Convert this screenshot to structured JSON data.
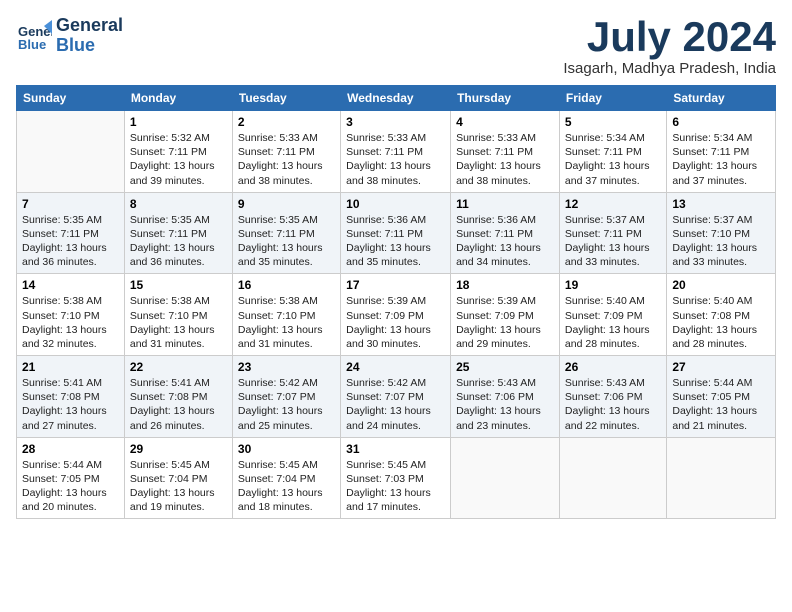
{
  "logo": {
    "line1": "General",
    "line2": "Blue"
  },
  "title": "July 2024",
  "subtitle": "Isagarh, Madhya Pradesh, India",
  "columns": [
    "Sunday",
    "Monday",
    "Tuesday",
    "Wednesday",
    "Thursday",
    "Friday",
    "Saturday"
  ],
  "weeks": [
    [
      {
        "day": "",
        "text": ""
      },
      {
        "day": "1",
        "text": "Sunrise: 5:32 AM\nSunset: 7:11 PM\nDaylight: 13 hours\nand 39 minutes."
      },
      {
        "day": "2",
        "text": "Sunrise: 5:33 AM\nSunset: 7:11 PM\nDaylight: 13 hours\nand 38 minutes."
      },
      {
        "day": "3",
        "text": "Sunrise: 5:33 AM\nSunset: 7:11 PM\nDaylight: 13 hours\nand 38 minutes."
      },
      {
        "day": "4",
        "text": "Sunrise: 5:33 AM\nSunset: 7:11 PM\nDaylight: 13 hours\nand 38 minutes."
      },
      {
        "day": "5",
        "text": "Sunrise: 5:34 AM\nSunset: 7:11 PM\nDaylight: 13 hours\nand 37 minutes."
      },
      {
        "day": "6",
        "text": "Sunrise: 5:34 AM\nSunset: 7:11 PM\nDaylight: 13 hours\nand 37 minutes."
      }
    ],
    [
      {
        "day": "7",
        "text": "Sunrise: 5:35 AM\nSunset: 7:11 PM\nDaylight: 13 hours\nand 36 minutes."
      },
      {
        "day": "8",
        "text": "Sunrise: 5:35 AM\nSunset: 7:11 PM\nDaylight: 13 hours\nand 36 minutes."
      },
      {
        "day": "9",
        "text": "Sunrise: 5:35 AM\nSunset: 7:11 PM\nDaylight: 13 hours\nand 35 minutes."
      },
      {
        "day": "10",
        "text": "Sunrise: 5:36 AM\nSunset: 7:11 PM\nDaylight: 13 hours\nand 35 minutes."
      },
      {
        "day": "11",
        "text": "Sunrise: 5:36 AM\nSunset: 7:11 PM\nDaylight: 13 hours\nand 34 minutes."
      },
      {
        "day": "12",
        "text": "Sunrise: 5:37 AM\nSunset: 7:11 PM\nDaylight: 13 hours\nand 33 minutes."
      },
      {
        "day": "13",
        "text": "Sunrise: 5:37 AM\nSunset: 7:10 PM\nDaylight: 13 hours\nand 33 minutes."
      }
    ],
    [
      {
        "day": "14",
        "text": "Sunrise: 5:38 AM\nSunset: 7:10 PM\nDaylight: 13 hours\nand 32 minutes."
      },
      {
        "day": "15",
        "text": "Sunrise: 5:38 AM\nSunset: 7:10 PM\nDaylight: 13 hours\nand 31 minutes."
      },
      {
        "day": "16",
        "text": "Sunrise: 5:38 AM\nSunset: 7:10 PM\nDaylight: 13 hours\nand 31 minutes."
      },
      {
        "day": "17",
        "text": "Sunrise: 5:39 AM\nSunset: 7:09 PM\nDaylight: 13 hours\nand 30 minutes."
      },
      {
        "day": "18",
        "text": "Sunrise: 5:39 AM\nSunset: 7:09 PM\nDaylight: 13 hours\nand 29 minutes."
      },
      {
        "day": "19",
        "text": "Sunrise: 5:40 AM\nSunset: 7:09 PM\nDaylight: 13 hours\nand 28 minutes."
      },
      {
        "day": "20",
        "text": "Sunrise: 5:40 AM\nSunset: 7:08 PM\nDaylight: 13 hours\nand 28 minutes."
      }
    ],
    [
      {
        "day": "21",
        "text": "Sunrise: 5:41 AM\nSunset: 7:08 PM\nDaylight: 13 hours\nand 27 minutes."
      },
      {
        "day": "22",
        "text": "Sunrise: 5:41 AM\nSunset: 7:08 PM\nDaylight: 13 hours\nand 26 minutes."
      },
      {
        "day": "23",
        "text": "Sunrise: 5:42 AM\nSunset: 7:07 PM\nDaylight: 13 hours\nand 25 minutes."
      },
      {
        "day": "24",
        "text": "Sunrise: 5:42 AM\nSunset: 7:07 PM\nDaylight: 13 hours\nand 24 minutes."
      },
      {
        "day": "25",
        "text": "Sunrise: 5:43 AM\nSunset: 7:06 PM\nDaylight: 13 hours\nand 23 minutes."
      },
      {
        "day": "26",
        "text": "Sunrise: 5:43 AM\nSunset: 7:06 PM\nDaylight: 13 hours\nand 22 minutes."
      },
      {
        "day": "27",
        "text": "Sunrise: 5:44 AM\nSunset: 7:05 PM\nDaylight: 13 hours\nand 21 minutes."
      }
    ],
    [
      {
        "day": "28",
        "text": "Sunrise: 5:44 AM\nSunset: 7:05 PM\nDaylight: 13 hours\nand 20 minutes."
      },
      {
        "day": "29",
        "text": "Sunrise: 5:45 AM\nSunset: 7:04 PM\nDaylight: 13 hours\nand 19 minutes."
      },
      {
        "day": "30",
        "text": "Sunrise: 5:45 AM\nSunset: 7:04 PM\nDaylight: 13 hours\nand 18 minutes."
      },
      {
        "day": "31",
        "text": "Sunrise: 5:45 AM\nSunset: 7:03 PM\nDaylight: 13 hours\nand 17 minutes."
      },
      {
        "day": "",
        "text": ""
      },
      {
        "day": "",
        "text": ""
      },
      {
        "day": "",
        "text": ""
      }
    ]
  ]
}
